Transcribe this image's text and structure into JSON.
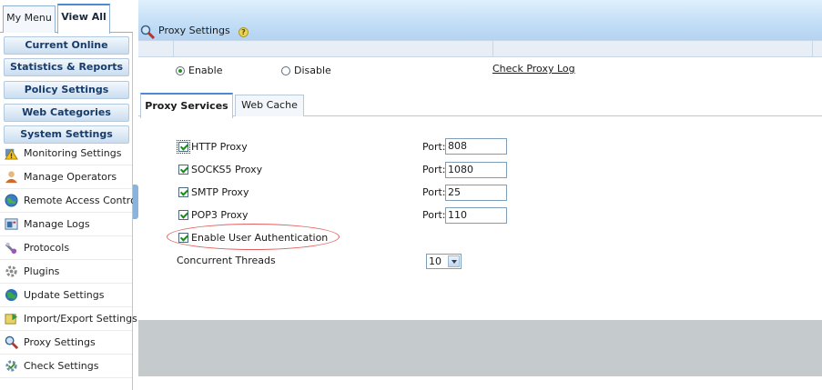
{
  "sidebar": {
    "tabs": [
      {
        "label": "My Menu"
      },
      {
        "label": "View All"
      }
    ],
    "sections": [
      {
        "label": "Current Online"
      },
      {
        "label": "Statistics & Reports"
      },
      {
        "label": "Policy Settings"
      },
      {
        "label": "Web Categories"
      },
      {
        "label": "System Settings"
      }
    ],
    "items": [
      {
        "label": "Monitoring Settings",
        "icon": "monitoring-warning-icon"
      },
      {
        "label": "Manage Operators",
        "icon": "user-icon"
      },
      {
        "label": "Remote Access Control",
        "icon": "globe-icon"
      },
      {
        "label": "Manage Logs",
        "icon": "log-icon"
      },
      {
        "label": "Protocols",
        "icon": "protocol-icon"
      },
      {
        "label": "Plugins",
        "icon": "plugin-gear-icon"
      },
      {
        "label": "Update Settings",
        "icon": "update-globe-icon"
      },
      {
        "label": "Import/Export Settings",
        "icon": "import-export-icon"
      },
      {
        "label": "Proxy Settings",
        "icon": "magnifier-icon"
      },
      {
        "label": "Check Settings",
        "icon": "check-gear-icon"
      }
    ]
  },
  "main": {
    "title": "Proxy Settings",
    "help_glyph": "?",
    "mode": {
      "enable_label": "Enable",
      "disable_label": "Disable",
      "selected": "Enable"
    },
    "check_log_link": "Check Proxy Log",
    "subtabs": [
      {
        "label": "Proxy Services"
      },
      {
        "label": "Web Cache"
      }
    ],
    "proxies": [
      {
        "label": "HTTP Proxy",
        "checked": true,
        "port_label": "Port:",
        "port": "808"
      },
      {
        "label": "SOCKS5 Proxy",
        "checked": true,
        "port_label": "Port:",
        "port": "1080"
      },
      {
        "label": "SMTP Proxy",
        "checked": true,
        "port_label": "Port:",
        "port": "25"
      },
      {
        "label": "POP3 Proxy",
        "checked": true,
        "port_label": "Port:",
        "port": "110"
      }
    ],
    "auth": {
      "label": "Enable User Authentication",
      "checked": true
    },
    "threads": {
      "label": "Concurrent Threads",
      "value": "10"
    }
  },
  "colors": {
    "accent": "#4f8ad0",
    "annotation_ellipse": "#e06060",
    "footer_bg": "#c5cbcd"
  }
}
